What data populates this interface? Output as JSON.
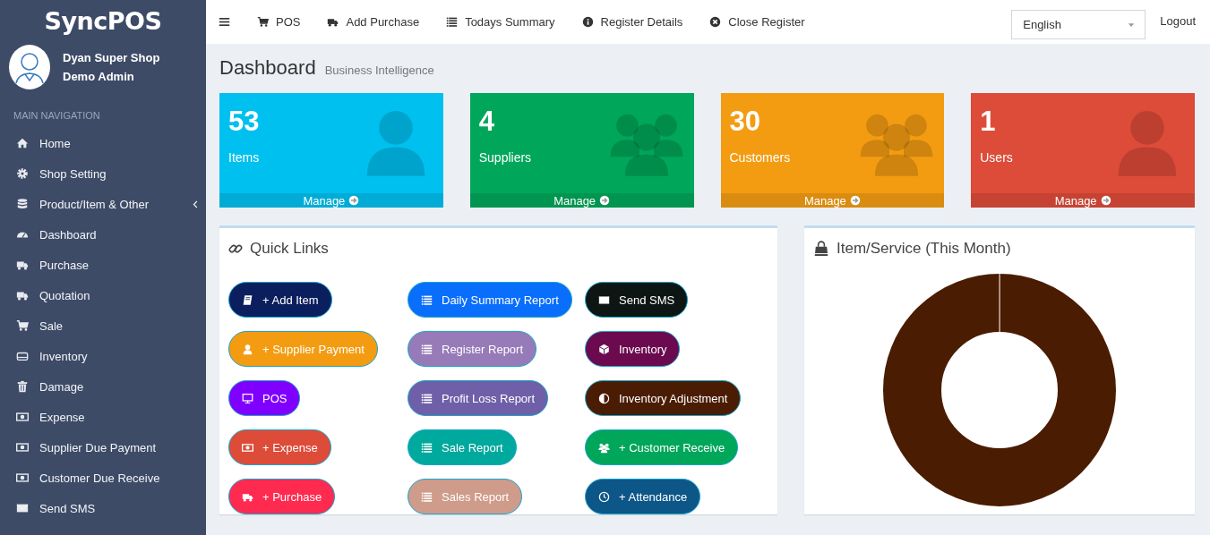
{
  "sidebar": {
    "logo": "SyncPOS",
    "user": {
      "shop": "Dyan Super Shop",
      "role": "Demo Admin"
    },
    "section_header": "MAIN NAVIGATION",
    "items": [
      {
        "label": "Home",
        "kind": "link"
      },
      {
        "label": "Shop Setting",
        "kind": "link"
      },
      {
        "label": "Product/Item & Other",
        "kind": "submenu"
      },
      {
        "label": "Dashboard",
        "kind": "link"
      },
      {
        "label": "Purchase",
        "kind": "link"
      },
      {
        "label": "Quotation",
        "kind": "link"
      },
      {
        "label": "Sale",
        "kind": "link"
      },
      {
        "label": "Inventory",
        "kind": "link"
      },
      {
        "label": "Damage",
        "kind": "link"
      },
      {
        "label": "Expense",
        "kind": "link"
      },
      {
        "label": "Supplier Due Payment",
        "kind": "link"
      },
      {
        "label": "Customer Due Receive",
        "kind": "link"
      },
      {
        "label": "Send SMS",
        "kind": "link"
      }
    ]
  },
  "topbar": {
    "links": [
      "POS",
      "Add Purchase",
      "Todays Summary",
      "Register Details",
      "Close Register"
    ],
    "language": {
      "value": "English"
    },
    "logout": "Logout"
  },
  "page_header": {
    "title": "Dashboard",
    "subtitle": "Business Intelligence"
  },
  "info_boxes": [
    {
      "value": "53",
      "label": "Items",
      "link": "Manage",
      "color": "#00c0ef"
    },
    {
      "value": "4",
      "label": "Suppliers",
      "link": "Manage",
      "color": "#00a65a"
    },
    {
      "value": "30",
      "label": "Customers",
      "link": "Manage",
      "color": "#f39c12"
    },
    {
      "value": "1",
      "label": "Users",
      "link": "Manage",
      "color": "#dd4b39"
    }
  ],
  "quick_links": {
    "title": "Quick Links",
    "buttons": [
      {
        "label": "+ Add Item",
        "color": "#0b1f5e"
      },
      {
        "label": "Daily Summary Report",
        "color": "#0a6efc"
      },
      {
        "label": "Send SMS",
        "color": "#0e1613"
      },
      {
        "label": "+ Supplier Payment",
        "color": "#f39c12"
      },
      {
        "label": "Register Report",
        "color": "#977bb8"
      },
      {
        "label": "Inventory",
        "color": "#6b0a4e"
      },
      {
        "label": "POS",
        "color": "#8000ff"
      },
      {
        "label": "Profit Loss Report",
        "color": "#6f5fa8"
      },
      {
        "label": "Inventory Adjustment",
        "color": "#4b1c04"
      },
      {
        "label": "+ Expense",
        "color": "#dd4b39"
      },
      {
        "label": "Sale Report",
        "color": "#00a99d"
      },
      {
        "label": "+ Customer Receive",
        "color": "#00a65a"
      },
      {
        "label": "+ Purchase",
        "color": "#ff2a50"
      },
      {
        "label": "Sales Report",
        "color": "#cf9b8b"
      },
      {
        "label": "+ Attendance",
        "color": "#0d5688"
      }
    ]
  },
  "item_service_chart": {
    "title": "Item/Service (This Month)"
  }
}
